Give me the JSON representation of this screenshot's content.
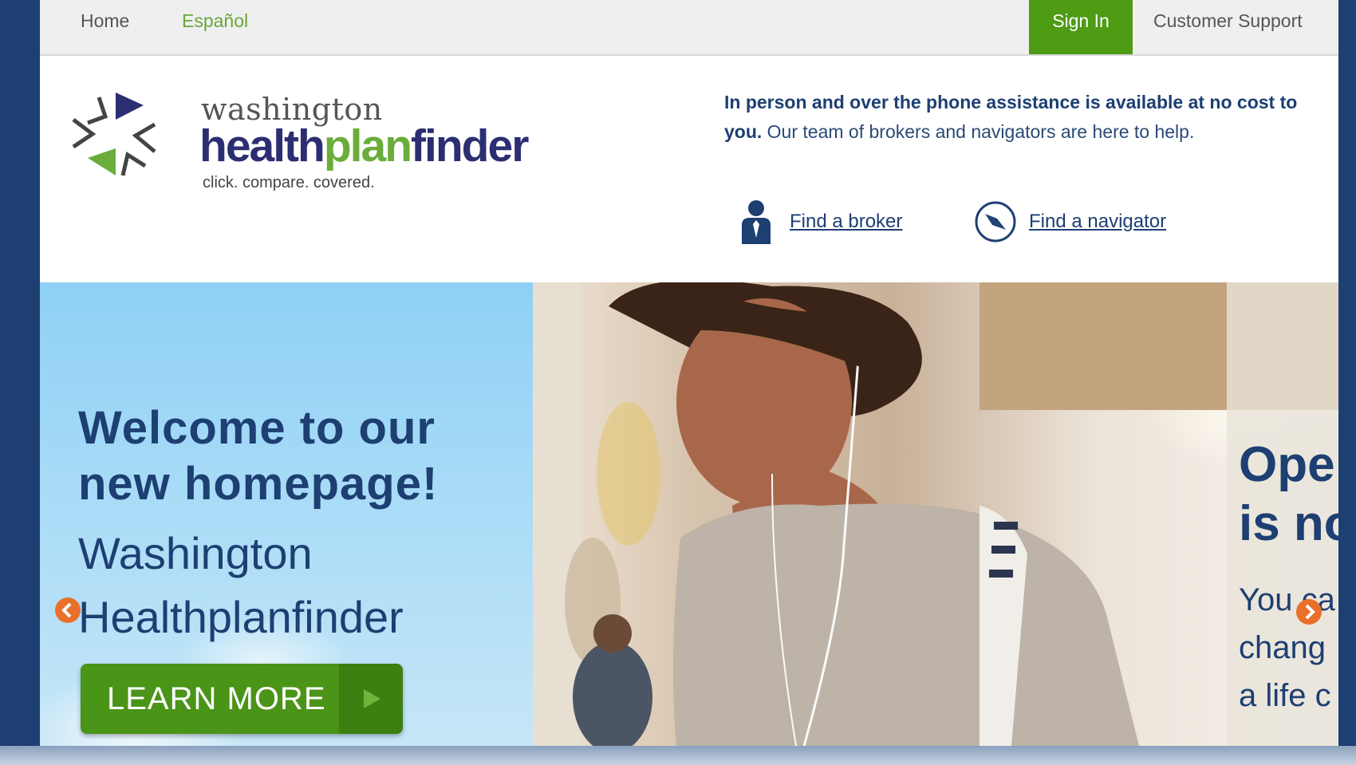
{
  "nav": {
    "home": "Home",
    "espanol": "Español",
    "sign_in": "Sign In",
    "support": "Customer Support"
  },
  "logo": {
    "line1": "washington",
    "health": "health",
    "plan": "plan",
    "finder": "finder",
    "tagline": "click. compare. covered."
  },
  "assist": {
    "bold": "In person and over the phone assistance is available at no cost to you.",
    "rest": " Our team of brokers and navigators are here to help."
  },
  "links": {
    "broker": "Find a broker",
    "navigator": "Find a navigator"
  },
  "hero": {
    "title_line1": "Welcome to our",
    "title_line2": "new homepage!",
    "sub_line1": "Washington",
    "sub_line2": "Healthplanfinder",
    "button": "LEARN MORE",
    "promo_line1": "Ope",
    "promo_line2": "is no",
    "promo_text1": "You ca",
    "promo_text2": "chang",
    "promo_text3": "a life c"
  },
  "colors": {
    "navy": "#1d3f72",
    "green": "#4e9b14",
    "orange": "#e8702a"
  }
}
